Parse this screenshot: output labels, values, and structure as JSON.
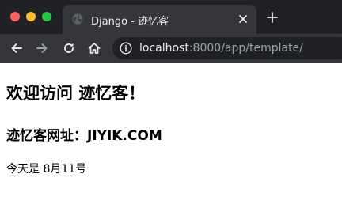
{
  "window": {
    "controls": {
      "close_color": "#fe5f57",
      "minimize_color": "#febc2e",
      "maximize_color": "#28c840"
    }
  },
  "tab": {
    "title": "Django - 迹忆客",
    "favicon": "globe-icon",
    "close_icon": "close-icon"
  },
  "new_tab": {
    "icon": "plus-icon"
  },
  "toolbar": {
    "back_icon": "back-arrow-icon",
    "forward_icon": "forward-arrow-icon",
    "reload_icon": "reload-icon",
    "home_icon": "home-icon",
    "site_info_icon": "info-icon"
  },
  "address_bar": {
    "host": "localhost",
    "rest": ":8000/app/template/"
  },
  "page": {
    "heading": "欢迎访问 迹忆客！",
    "subheading": "迹忆客网址：JIYIK.COM",
    "paragraph": "今天是 8月11号"
  },
  "colors": {
    "tabstrip_bg": "#202124",
    "toolbar_bg": "#35363a",
    "omnibox_bg": "#202124",
    "url_host": "#e8eaed",
    "url_rest": "#9aa0a6",
    "page_bg": "#ffffff"
  }
}
